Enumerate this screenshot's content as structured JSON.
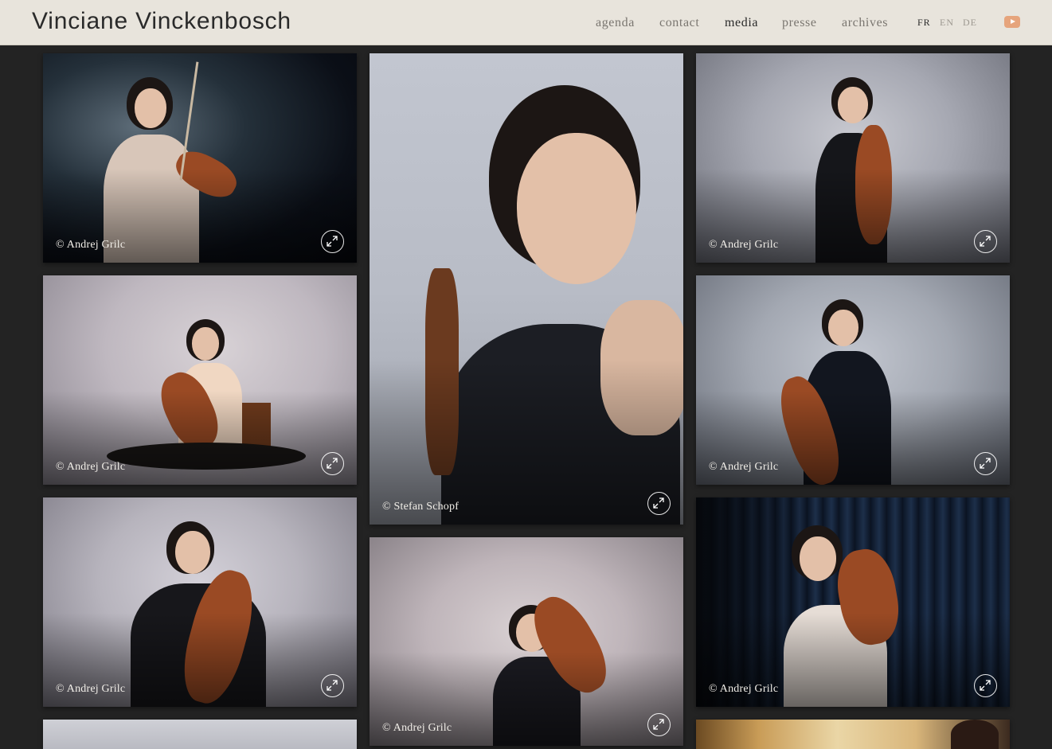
{
  "site": {
    "title": "Vinciane Vinckenbosch"
  },
  "nav": {
    "items": [
      {
        "label": "agenda",
        "active": false
      },
      {
        "label": "contact",
        "active": false
      },
      {
        "label": "media",
        "active": true
      },
      {
        "label": "presse",
        "active": false
      },
      {
        "label": "archives",
        "active": false
      }
    ]
  },
  "languages": {
    "items": [
      {
        "label": "FR",
        "active": true
      },
      {
        "label": "EN",
        "active": false
      },
      {
        "label": "DE",
        "active": false
      }
    ]
  },
  "social": {
    "icon": "youtube-icon",
    "color": "#e6a47c"
  },
  "gallery": {
    "photos": [
      {
        "credit": "© Andrej Grilc"
      },
      {
        "credit": "© Stefan Schopf"
      },
      {
        "credit": "© Andrej Grilc"
      },
      {
        "credit": "© Andrej Grilc"
      },
      {
        "credit": "© Andrej Grilc"
      },
      {
        "credit": "© Andrej Grilc"
      },
      {
        "credit": "© Andrej Grilc"
      },
      {
        "credit": "© Andrej Grilc"
      },
      {
        "credit": ""
      },
      {
        "credit": ""
      }
    ],
    "expand_icon": "expand-arrows-icon"
  },
  "colors": {
    "header_bg": "#e8e4dc",
    "page_bg": "#232323",
    "accent": "#e6a47c"
  }
}
